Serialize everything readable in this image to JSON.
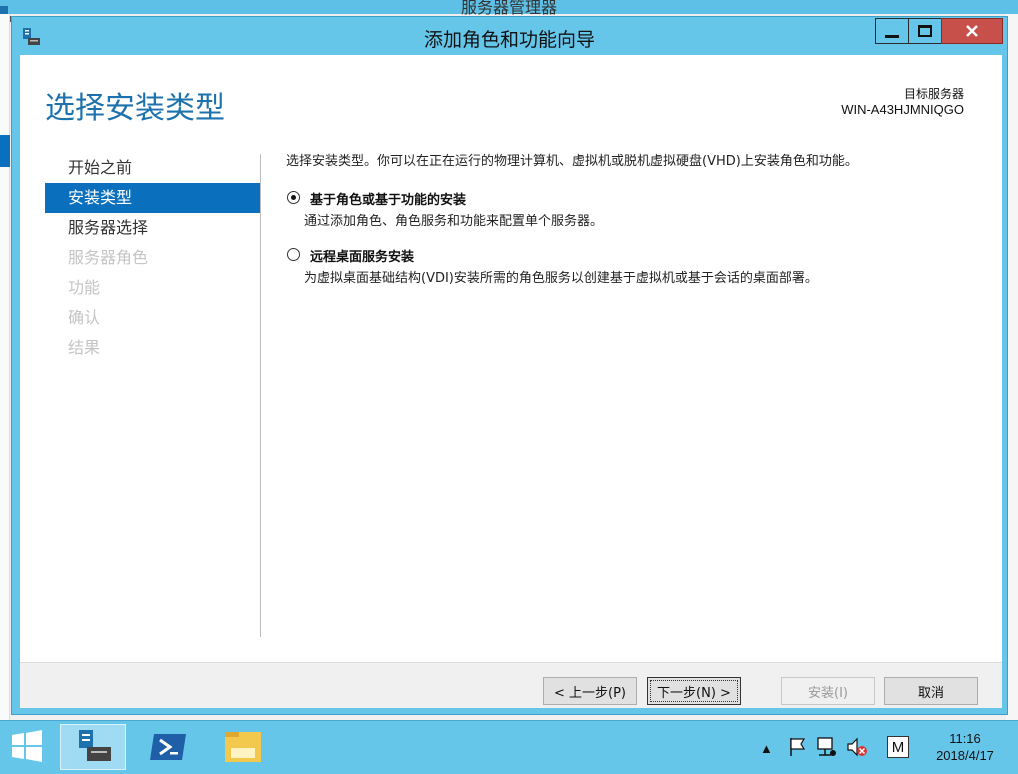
{
  "background_window": {
    "title": "服务器管理器"
  },
  "dialog": {
    "title": "添加角色和功能向导",
    "page_title": "选择安装类型",
    "target_server_label": "目标服务器",
    "target_server_name": "WIN-A43HJMNIQGO",
    "nav_items": [
      {
        "label": "开始之前",
        "state": "normal"
      },
      {
        "label": "安装类型",
        "state": "active"
      },
      {
        "label": "服务器选择",
        "state": "normal"
      },
      {
        "label": "服务器角色",
        "state": "disabled"
      },
      {
        "label": "功能",
        "state": "disabled"
      },
      {
        "label": "确认",
        "state": "disabled"
      },
      {
        "label": "结果",
        "state": "disabled"
      }
    ],
    "intro": "选择安装类型。你可以在正在运行的物理计算机、虚拟机或脱机虚拟硬盘(VHD)上安装角色和功能。",
    "options": [
      {
        "label": "基于角色或基于功能的安装",
        "description": "通过添加角色、角色服务和功能来配置单个服务器。",
        "selected": true
      },
      {
        "label": "远程桌面服务安装",
        "description": "为虚拟桌面基础结构(VDI)安装所需的角色服务以创建基于虚拟机或基于会话的桌面部署。",
        "selected": false
      }
    ],
    "buttons": {
      "prev": "< 上一步(P)",
      "next": "下一步(N) >",
      "install": "安装(I)",
      "cancel": "取消"
    }
  },
  "taskbar": {
    "time": "11:16",
    "date": "2018/4/17",
    "ime": "M"
  },
  "colors": {
    "titlebar": "#66c6ea",
    "accent": "#0a6fbd",
    "page_title": "#1d72ad",
    "close": "#c7504a"
  }
}
